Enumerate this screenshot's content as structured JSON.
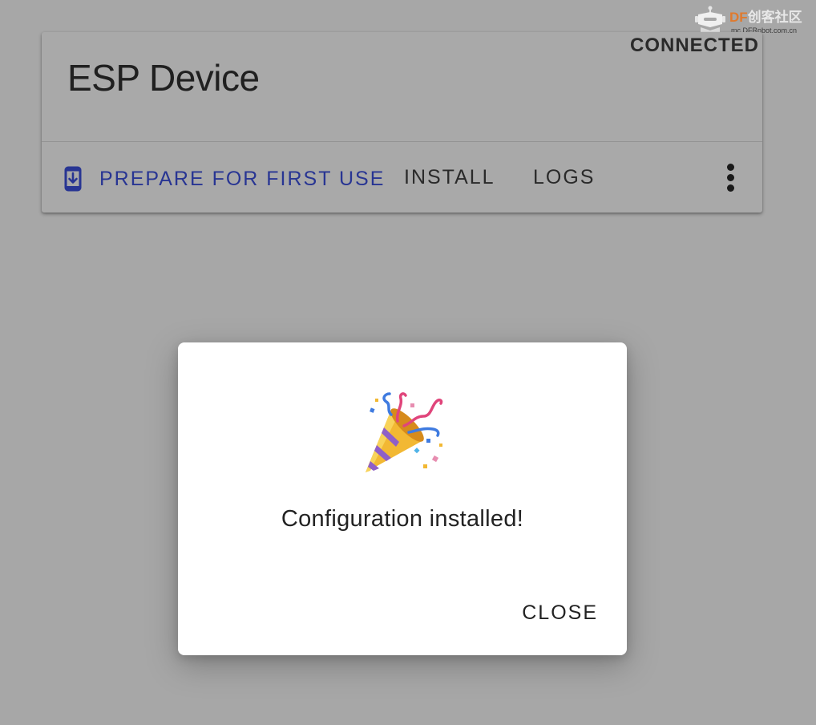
{
  "device": {
    "title": "ESP Device",
    "status": "CONNECTED",
    "actions": {
      "prepare": "PREPARE FOR FIRST USE",
      "install": "INSTALL",
      "logs": "LOGS"
    },
    "icons": {
      "prepare": "phone-download-icon",
      "menu": "more-vert-icon"
    }
  },
  "dialog": {
    "icon": "party-popper-icon",
    "message": "Configuration installed!",
    "close_label": "CLOSE"
  },
  "watermark": {
    "brand_df": "DF",
    "brand_rest": "创客社区",
    "url": "mc.DFRobot.com.cn"
  },
  "colors": {
    "backdrop": "#a7a7a7",
    "primary": "#283593",
    "dialog_bg": "#ffffff"
  }
}
